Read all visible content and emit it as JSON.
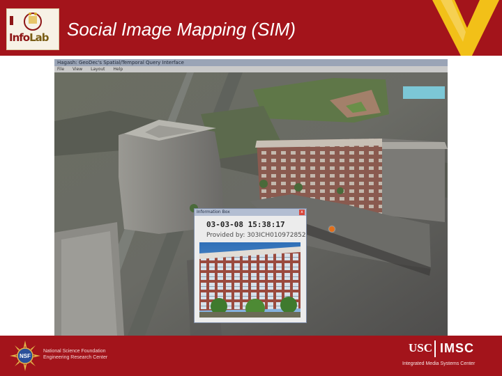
{
  "slide": {
    "title": "Social Image Mapping (SIM)",
    "logo_top_text": "Info",
    "logo_bottom_text": "Lab"
  },
  "app": {
    "window_title": "Hagash: GeoDec's Spatial/Temporal Query Interface",
    "menu": [
      "File",
      "View",
      "Layout",
      "Help"
    ]
  },
  "infobox": {
    "title": "Information Box",
    "close_label": "x",
    "datetime": "03-03-08 15:38:17",
    "provider": "Provided by: 303ICH010972852"
  },
  "footer": {
    "nsf_line1": "National Science Foundation",
    "nsf_line2": "Engineering Research Center",
    "usc": "USC",
    "imsc": "IMSC",
    "imsc_sub": "Integrated Media Systems Center"
  },
  "colors": {
    "brand_red": "#a3141b",
    "brand_gold": "#f2c018",
    "marker_orange": "#e36f1a"
  },
  "icons": {
    "header_mark": "v-logo-icon",
    "nsf": "nsf-seal-icon",
    "location": "location-marker-icon"
  }
}
